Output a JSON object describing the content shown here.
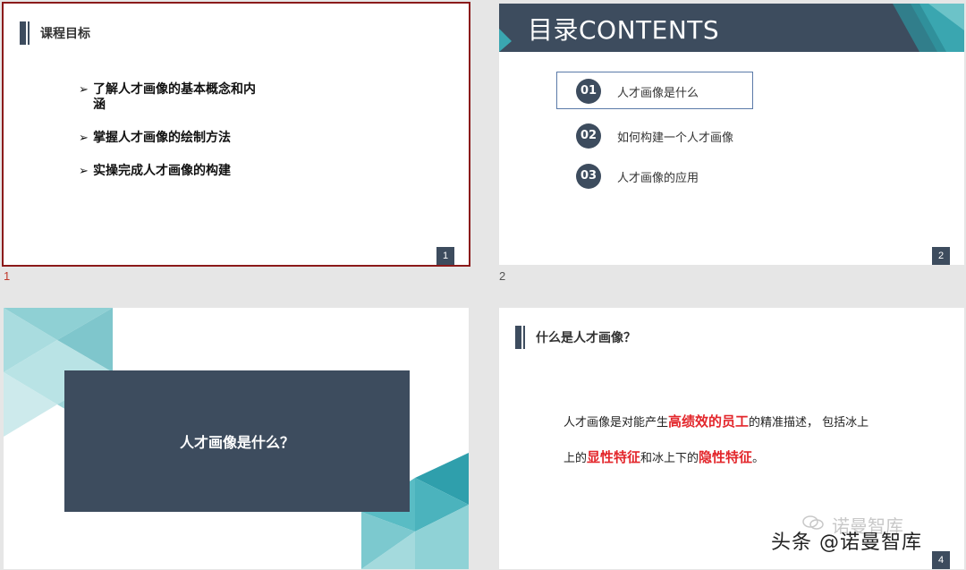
{
  "slides": [
    {
      "num": "1",
      "title": "课程目标",
      "bullets": [
        "了解人才画像的基本概念和内涵",
        "掌握人才画像的绘制方法",
        "实操完成人才画像的构建"
      ],
      "bullet_lines": [
        [
          "了解人才画像的基本概念和内",
          "涵"
        ],
        [
          "掌握人才画像的绘制方法"
        ],
        [
          "实操完成人才画像的构建"
        ]
      ],
      "page_num": "1"
    },
    {
      "num": "2",
      "title": "目录CONTENTS",
      "items": [
        {
          "num": "01",
          "label": "人才画像是什么"
        },
        {
          "num": "02",
          "label": "如何构建一个人才画像"
        },
        {
          "num": "03",
          "label": "人才画像的应用"
        }
      ],
      "page_num": "2"
    },
    {
      "title": "人才画像是什么？"
    },
    {
      "title": "什么是人才画像？",
      "para": {
        "t1": "人才画像是对能产生",
        "h1": "高绩效的员工",
        "t2": "的精准描述， 包括冰上",
        "t3": "上的",
        "h2": "显性特征",
        "t4": "和冰上下的",
        "h3": "隐性特征",
        "t5": "。"
      },
      "page_num": "4"
    }
  ],
  "watermark": {
    "main": "头条 @诺曼智库",
    "ghost": "诺曼智库"
  },
  "colors": {
    "navy": "#3d4c5e",
    "teal": "#3aa6b0",
    "red": "#e3262b",
    "border_selected": "#8b1a1a"
  }
}
